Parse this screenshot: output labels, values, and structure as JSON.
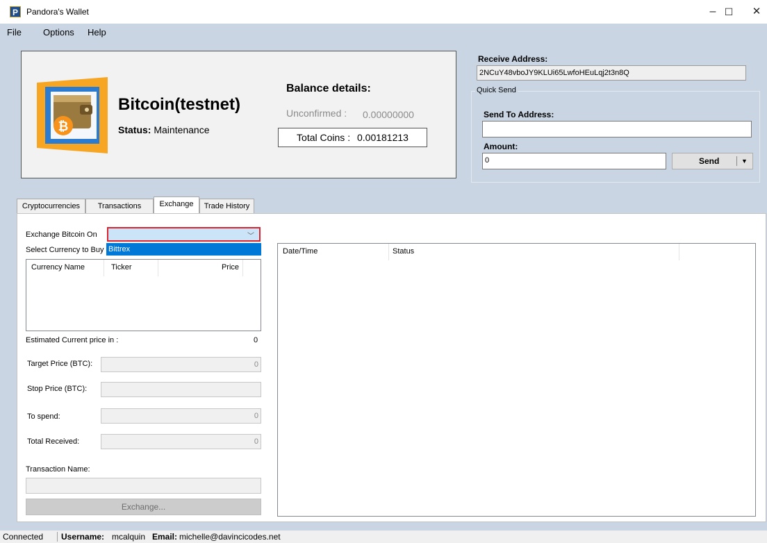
{
  "window": {
    "title": "Pandora's Wallet",
    "icon_letter": "P",
    "minimize": "–",
    "maximize": "☐",
    "close": "✕"
  },
  "menu": {
    "file": "File",
    "options": "Options",
    "help": "Help"
  },
  "coin": {
    "name": "Bitcoin(testnet)",
    "status_label": "Status:",
    "status_value": "Maintenance"
  },
  "balance": {
    "header": "Balance details:",
    "unconfirmed_label": "Unconfirmed :",
    "unconfirmed_value": "0.00000000",
    "total_label": "Total Coins :",
    "total_value": "0.00181213"
  },
  "receive": {
    "label": "Receive Address:",
    "address": "2NCuY48vboJY9KLUi65LwfoHEuLqj2t3n8Q"
  },
  "quick_send": {
    "group_label": "Quick Send",
    "to_label": "Send To Address:",
    "to_value": "",
    "amount_label": "Amount:",
    "amount_value": "0",
    "send_label": "Send",
    "dropdown_glyph": "▼"
  },
  "tabs": [
    "Cryptocurrencies",
    "Transactions",
    "Exchange",
    "Trade History"
  ],
  "exchange": {
    "exchange_on_label": "Exchange Bitcoin On",
    "combo_value": "",
    "combo_arrow": "﹀",
    "dropdown_option": "Bittrex",
    "select_currency_label": "Select Currency to Buy",
    "columns": [
      "Currency Name",
      "Ticker",
      "Price"
    ],
    "estimated_label": "Estimated Current price in :",
    "estimated_value": "0",
    "target_label": "Target Price (BTC):",
    "target_value": "0",
    "stop_label": "Stop Price (BTC):",
    "stop_value": "",
    "spend_label": "To spend:",
    "spend_value": "0",
    "received_label": "Total Received:",
    "received_value": "0",
    "txname_label": "Transaction Name:",
    "txname_value": "",
    "exchange_button": "Exchange..."
  },
  "history": {
    "columns": [
      "Date/Time",
      "Status"
    ]
  },
  "statusbar": {
    "connected": "Connected",
    "username_label": "Username:",
    "username": "mcalquin",
    "email_label": "Email:",
    "email": "michelle@davincicodes.net"
  },
  "colors": {
    "background": "#c9d5e3",
    "accent": "#0078d7",
    "highlight_border": "#d9232e",
    "bitcoin": "#f7931a"
  }
}
